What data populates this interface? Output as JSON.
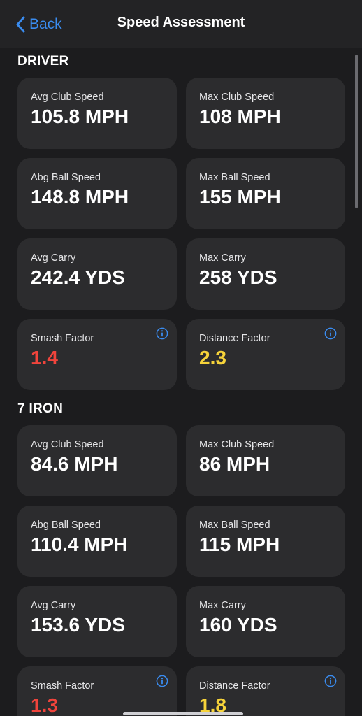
{
  "nav": {
    "back_label": "Back",
    "title": "Speed Assessment"
  },
  "sections": [
    {
      "title": "DRIVER",
      "cards": [
        {
          "label": "Avg Club Speed",
          "value": "105.8 MPH"
        },
        {
          "label": "Max Club Speed",
          "value": "108 MPH"
        },
        {
          "label": "Abg Ball Speed",
          "value": "148.8 MPH"
        },
        {
          "label": "Max Ball Speed",
          "value": "155 MPH"
        },
        {
          "label": "Avg Carry",
          "value": "242.4 YDS"
        },
        {
          "label": "Max Carry",
          "value": "258 YDS"
        },
        {
          "label": "Smash Factor",
          "value": "1.4",
          "value_color": "#f0443c"
        },
        {
          "label": "Distance Factor",
          "value": "2.3",
          "value_color": "#f6d33a"
        }
      ]
    },
    {
      "title": "7 IRON",
      "cards": [
        {
          "label": "Avg Club Speed",
          "value": "84.6 MPH"
        },
        {
          "label": "Max Club Speed",
          "value": "86 MPH"
        },
        {
          "label": "Abg Ball Speed",
          "value": "110.4 MPH"
        },
        {
          "label": "Max Ball Speed",
          "value": "115 MPH"
        },
        {
          "label": "Avg Carry",
          "value": "153.6 YDS"
        },
        {
          "label": "Max Carry",
          "value": "160 YDS"
        },
        {
          "label": "Smash Factor",
          "value": "1.3",
          "value_color": "#f0443c"
        },
        {
          "label": "Distance Factor",
          "value": "1.8",
          "value_color": "#f6d33a"
        }
      ]
    }
  ],
  "colors": {
    "background": "#1c1c1e",
    "card": "#2c2c2e",
    "accent": "#3a8cf0",
    "factor_low": "#f0443c",
    "factor_mid": "#f6d33a"
  }
}
